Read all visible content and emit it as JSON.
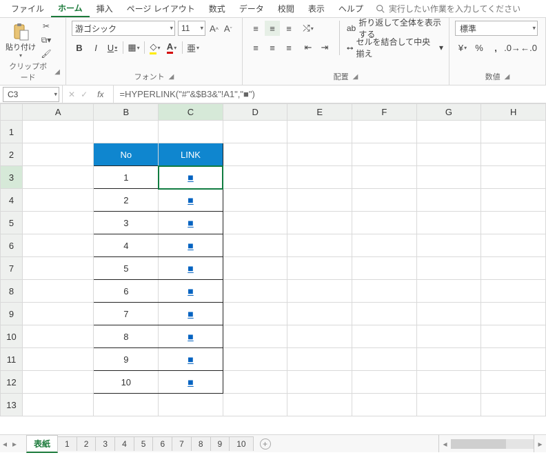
{
  "menu": {
    "items": [
      "ファイル",
      "ホーム",
      "挿入",
      "ページ レイアウト",
      "数式",
      "データ",
      "校閲",
      "表示",
      "ヘルプ"
    ],
    "active_index": 1,
    "search_hint": "実行したい作業を入力してください"
  },
  "ribbon": {
    "clipboard": {
      "paste": "貼り付け",
      "label": "クリップボード"
    },
    "font": {
      "name": "游ゴシック",
      "size": "11",
      "label": "フォント"
    },
    "alignment": {
      "wrap": "折り返して全体を表示する",
      "merge": "セルを結合して中央揃え",
      "label": "配置"
    },
    "number": {
      "format": "標準",
      "label": "数値"
    }
  },
  "namebox": "C3",
  "formula": "=HYPERLINK(\"#\"&$B3&\"!A1\",\"■\")",
  "columns": [
    "A",
    "B",
    "C",
    "D",
    "E",
    "F",
    "G",
    "H"
  ],
  "rows": [
    "1",
    "2",
    "3",
    "4",
    "5",
    "6",
    "7",
    "8",
    "9",
    "10",
    "11",
    "12",
    "13"
  ],
  "table": {
    "head": {
      "no": "No",
      "link": "LINK"
    },
    "items": [
      {
        "no": "1",
        "link": "■"
      },
      {
        "no": "2",
        "link": "■"
      },
      {
        "no": "3",
        "link": "■"
      },
      {
        "no": "4",
        "link": "■"
      },
      {
        "no": "5",
        "link": "■"
      },
      {
        "no": "6",
        "link": "■"
      },
      {
        "no": "7",
        "link": "■"
      },
      {
        "no": "8",
        "link": "■"
      },
      {
        "no": "9",
        "link": "■"
      },
      {
        "no": "10",
        "link": "■"
      }
    ]
  },
  "tabs": {
    "items": [
      "表紙",
      "1",
      "2",
      "3",
      "4",
      "5",
      "6",
      "7",
      "8",
      "9",
      "10"
    ],
    "active_index": 0
  }
}
